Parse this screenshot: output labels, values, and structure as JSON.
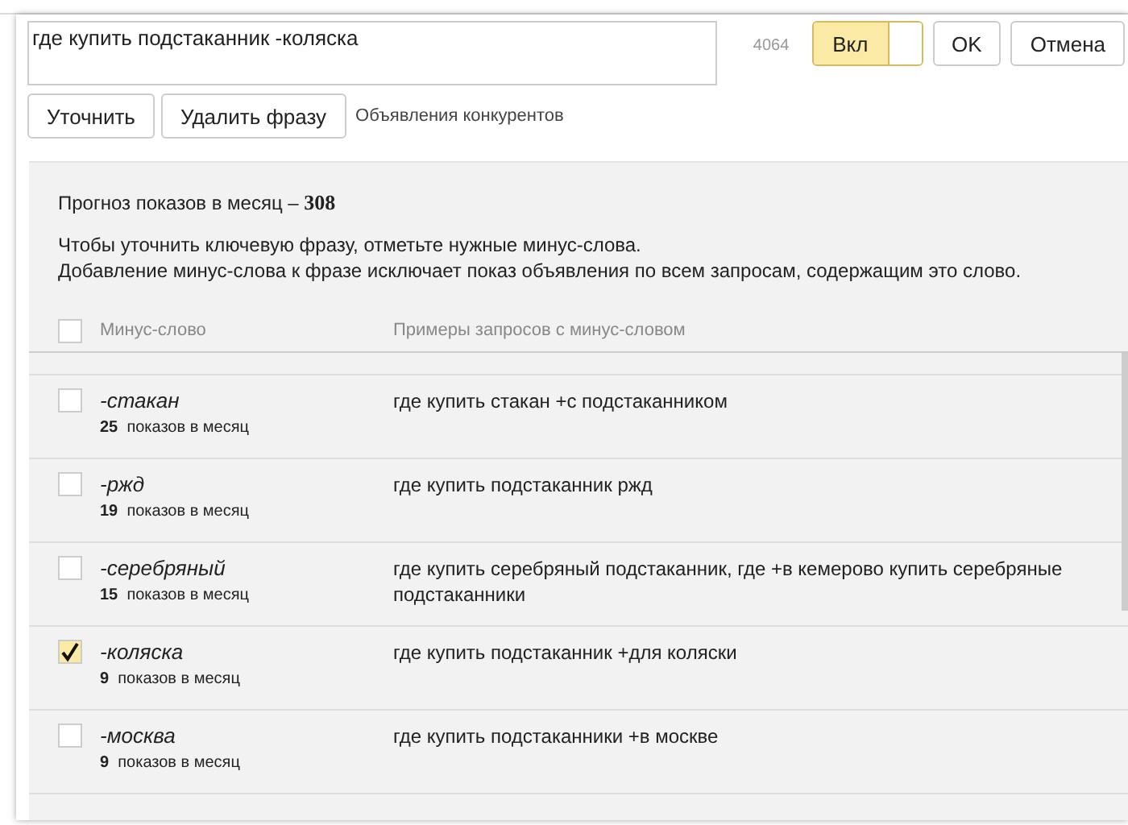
{
  "editor": {
    "phrase": "где купить подстаканник -коляска",
    "count": "4064",
    "toggle": {
      "label": "Вкл",
      "on": true
    },
    "ok": "OK",
    "cancel": "Отмена"
  },
  "actions": {
    "refine": "Уточнить",
    "delete": "Удалить фразу",
    "competitors": "Объявления конкурентов"
  },
  "forecast": {
    "label": "Прогноз показов в месяц – ",
    "value": "308"
  },
  "hint": [
    "Чтобы уточнить ключевую фразу, отметьте нужные минус-слова.",
    "Добавление минус-слова к фразе исключает показ объявления по всем запросам, содержащим это слово."
  ],
  "table": {
    "select_all": {
      "checked": false
    },
    "columns": [
      "Минус-слово",
      "Примеры запросов с минус-словом"
    ],
    "rows": [
      {
        "word": "-стакан",
        "count": "25",
        "unit": "показов в месяц",
        "example": "где купить стакан +с подстаканником",
        "checked": false
      },
      {
        "word": "-ржд",
        "count": "19",
        "unit": "показов в месяц",
        "example": "где купить подстаканник ржд",
        "checked": false
      },
      {
        "word": "-серебряный",
        "count": "15",
        "unit": "показов в месяц",
        "example": "где купить серебряный подстаканник, где +в кемерово купить серебряные подстаканники",
        "checked": false
      },
      {
        "word": "-коляска",
        "count": "9",
        "unit": "показов в месяц",
        "example": "где купить подстаканник +для коляски",
        "checked": true
      },
      {
        "word": "-москва",
        "count": "9",
        "unit": "показов в месяц",
        "example": "где купить подстаканники +в москве",
        "checked": false
      }
    ]
  }
}
